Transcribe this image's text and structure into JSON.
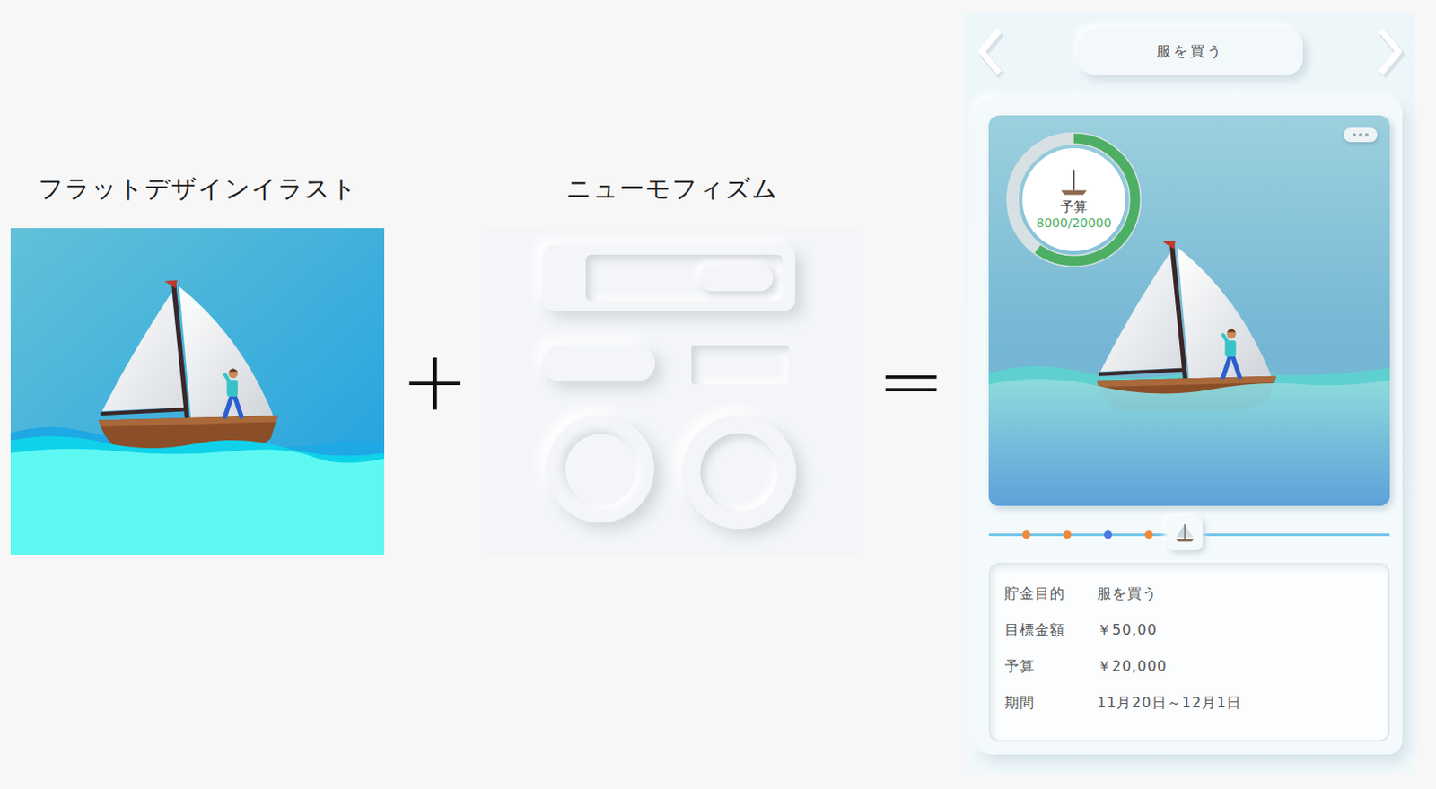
{
  "sections": [
    {
      "title": "フラットデザインイラスト"
    },
    {
      "title": "ニューモフィズム"
    }
  ],
  "operators": [
    "+",
    "="
  ],
  "app": {
    "title": "服を買う",
    "gauge": {
      "label": "予算",
      "reading": "8000/20000",
      "level": 0.6
    },
    "timeline": {
      "level": 0.49,
      "dots": [
        {
          "color": "#f0893a"
        },
        {
          "color": "#f0893a"
        },
        {
          "color": "#4a78e0"
        },
        {
          "color": "#f0893a"
        }
      ]
    },
    "details": [
      {
        "label": "貯金目的",
        "value": "服を買う"
      },
      {
        "label": "目標金額",
        "value": "￥50,00"
      },
      {
        "label": "予算",
        "value": "￥20,000"
      },
      {
        "label": "期間",
        "value": "11月20日～12月1日"
      }
    ]
  }
}
